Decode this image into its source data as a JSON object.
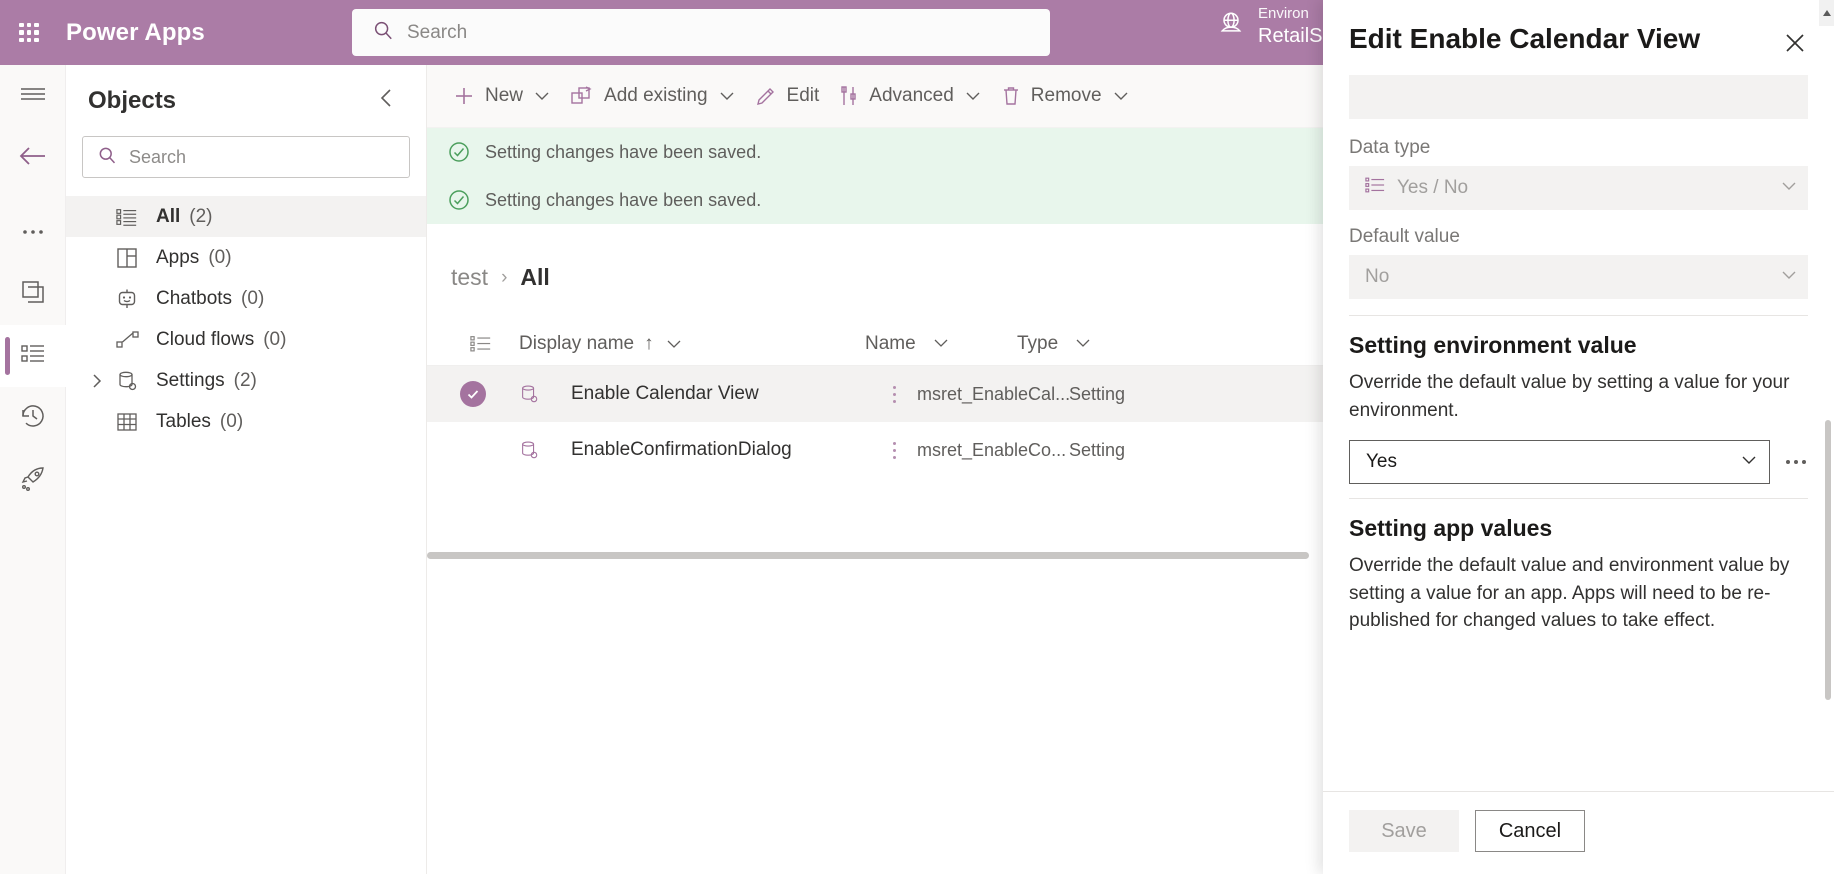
{
  "topbar": {
    "brand": "Power Apps",
    "waffle_icon": "waffle-grid-icon",
    "search": {
      "placeholder": "Search",
      "value": "",
      "icon": "search-icon"
    },
    "environment": {
      "icon": "globe-icon",
      "label": "Environ",
      "name": "RetailS"
    }
  },
  "rail": {
    "items": [
      {
        "name": "hamburger",
        "icon": "hamburger-menu-icon",
        "active": false
      },
      {
        "name": "back",
        "icon": "back-arrow-icon",
        "active": false
      },
      {
        "name": "more",
        "icon": "ellipsis-icon",
        "active": false
      },
      {
        "name": "apps",
        "icon": "apps-pages-icon",
        "active": false
      },
      {
        "name": "objects",
        "icon": "objects-list-icon",
        "active": true
      },
      {
        "name": "recent",
        "icon": "history-clock-icon",
        "active": false
      },
      {
        "name": "publish",
        "icon": "rocket-icon",
        "active": false
      }
    ]
  },
  "objects_panel": {
    "title": "Objects",
    "collapse_icon": "chevron-left-icon",
    "search": {
      "placeholder": "Search",
      "value": "",
      "icon": "search-icon"
    },
    "tree": [
      {
        "label": "All",
        "count": "(2)",
        "icon": "list-all-icon",
        "selected": true,
        "expandable": false
      },
      {
        "label": "Apps",
        "count": "(0)",
        "icon": "apps-grid-icon",
        "selected": false,
        "expandable": false
      },
      {
        "label": "Chatbots",
        "count": "(0)",
        "icon": "chatbot-icon",
        "selected": false,
        "expandable": false
      },
      {
        "label": "Cloud flows",
        "count": "(0)",
        "icon": "cloud-flow-icon",
        "selected": false,
        "expandable": false
      },
      {
        "label": "Settings",
        "count": "(2)",
        "icon": "settings-db-icon",
        "selected": false,
        "expandable": true
      },
      {
        "label": "Tables",
        "count": "(0)",
        "icon": "table-icon",
        "selected": false,
        "expandable": false
      }
    ]
  },
  "command_bar": {
    "items": [
      {
        "label": "New",
        "icon": "plus-icon",
        "caret": true
      },
      {
        "label": "Add existing",
        "icon": "add-existing-icon",
        "caret": true
      },
      {
        "label": "Edit",
        "icon": "pencil-icon",
        "caret": false
      },
      {
        "label": "Advanced",
        "icon": "advanced-icon",
        "caret": true
      },
      {
        "label": "Remove",
        "icon": "trash-icon",
        "caret": true
      }
    ]
  },
  "notifications": [
    {
      "icon": "check-circle-icon",
      "text": "Setting changes have been saved."
    },
    {
      "icon": "check-circle-icon",
      "text": "Setting changes have been saved."
    }
  ],
  "breadcrumb": {
    "parent": "test",
    "separator": "›",
    "current": "All"
  },
  "grid": {
    "columns": [
      {
        "key": "rowicon",
        "label": "",
        "sort": "",
        "caret": false
      },
      {
        "key": "display",
        "label": "Display name",
        "sort": "↑",
        "caret": true
      },
      {
        "key": "name",
        "label": "Name",
        "sort": "",
        "caret": true
      },
      {
        "key": "type",
        "label": "Type",
        "sort": "",
        "caret": true
      }
    ],
    "header_icon": "column-options-icon",
    "rows": [
      {
        "selected": true,
        "icon": "setting-record-icon",
        "display": "Enable Calendar View",
        "name": "msret_EnableCal...",
        "type": "Setting"
      },
      {
        "selected": false,
        "icon": "setting-record-icon",
        "display": "EnableConfirmationDialog",
        "name": "msret_EnableCo...",
        "type": "Setting"
      }
    ]
  },
  "panel": {
    "title": "Edit Enable Calendar View",
    "close_icon": "close-icon",
    "top_blank_field": {
      "value": "",
      "disabled": true
    },
    "data_type": {
      "label": "Data type",
      "value": "Yes / No",
      "icon": "choice-list-icon",
      "caret_icon": "chevron-down-icon",
      "disabled": true
    },
    "default_value": {
      "label": "Default value",
      "value": "No",
      "caret_icon": "chevron-down-icon",
      "disabled": true
    },
    "environment_section": {
      "title": "Setting environment value",
      "description": "Override the default value by setting a value for your environment.",
      "dropdown_value": "Yes",
      "caret_icon": "chevron-down-icon",
      "more_icon": "ellipsis-icon"
    },
    "app_section": {
      "title": "Setting app values",
      "description": "Override the default value and environment value by setting a value for an app. Apps will need to be re-published for changed values to take effect."
    },
    "footer": {
      "save_label": "Save",
      "save_disabled": true,
      "cancel_label": "Cancel"
    }
  },
  "colors": {
    "brand_purple": "#ab7ca6",
    "accent_purple": "#a4739f",
    "success_green_bg": "#e8f6ec",
    "success_green": "#4c9f5d",
    "neutral_bg": "#faf9f8",
    "selected_row": "#f3f2f1"
  }
}
